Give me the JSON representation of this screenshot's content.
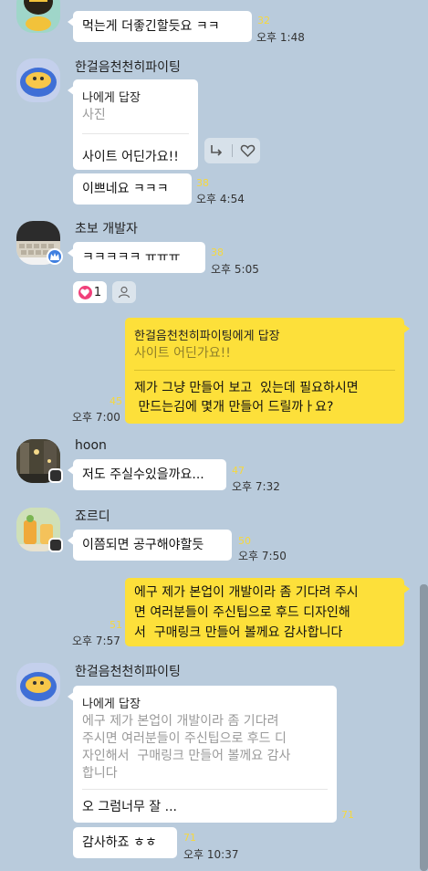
{
  "messages": {
    "m1": {
      "text": "먹는게 더좋긴할듯요 ㅋㅋ",
      "unread": "32",
      "time": "오후 1:48"
    },
    "m2": {
      "sender": "한걸음천천히파이팅",
      "reply_label": "나에게 답장",
      "reply_quote": "사진",
      "text": "사이트 어딘가요!!",
      "text2": "이쁘네요 ㅋㅋㅋ",
      "unread": "38",
      "time": "오후 4:54"
    },
    "m3": {
      "sender": "초보 개발자",
      "text": "ㅋㅋㅋㅋㅋ ㅠㅠㅠ",
      "unread": "38",
      "time": "오후 5:05",
      "reaction_count": "1"
    },
    "m4": {
      "reply_label": "한걸음천천히파이팅에게 답장",
      "reply_quote": "사이트 어딘가요!!",
      "line1": "제가 그냥 만들어 보고  있는데 필요하시면",
      "line2": " 만드는김에 몇개 만들어 드릴까ㅏ요?",
      "unread": "45",
      "time": "오후 7:00"
    },
    "m5": {
      "sender": "hoon",
      "text": "저도 주실수있을까요...",
      "unread": "47",
      "time": "오후 7:32"
    },
    "m6": {
      "sender": "죠르디",
      "text": "이쯤되면 공구해야할듯",
      "unread": "50",
      "time": "오후 7:50"
    },
    "m7": {
      "line1": "에구 제가 본업이 개발이라 좀 기다려 주시",
      "line2": "면 여러분들이 주신팁으로 후드 디자인해",
      "line3": "서  구매링크 만들어 볼께요 감사합니다",
      "unread": "51",
      "time": "오후 7:57"
    },
    "m8": {
      "sender": "한걸음천천히파이팅",
      "reply_label": "나에게 답장",
      "q1": "에구 제가 본업이 개발이라 좀 기다려",
      "q2": "주시면 여러분들이 주신팁으로 후드 디",
      "q3": "자인해서  구매링크 만들어 볼께요 감사",
      "q4": "합니다",
      "text": "오 그럼너무 잘 ...",
      "unread": "71",
      "text2": "감사하죠 ㅎㅎ",
      "unread2": "71",
      "time": "오후 10:37"
    }
  },
  "colors": {
    "background": "#b9cbdc",
    "my_bubble": "#fde03a",
    "other_bubble": "#ffffff",
    "unread": "#f6d83d"
  }
}
